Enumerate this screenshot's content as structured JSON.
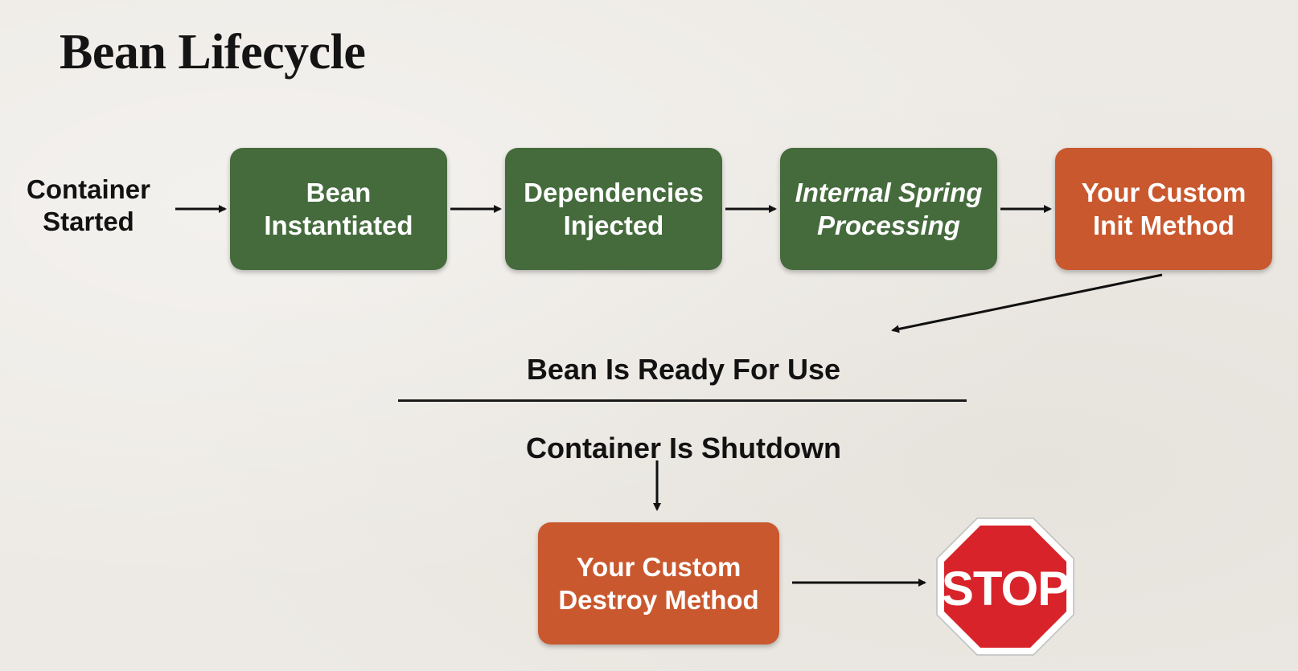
{
  "title": "Bean Lifecycle",
  "start": {
    "line1": "Container",
    "line2": "Started"
  },
  "steps": [
    {
      "line1": "Bean",
      "line2": "Instantiated",
      "color": "#456b3d"
    },
    {
      "line1": "Dependencies",
      "line2": "Injected",
      "color": "#456b3d"
    },
    {
      "line1": "Internal Spring",
      "line2": "Processing",
      "color": "#456b3d"
    },
    {
      "line1": "Your Custom",
      "line2": "Init Method",
      "color": "#c9582e"
    }
  ],
  "ready_label": "Bean Is Ready For Use",
  "shutdown_label": "Container Is Shutdown",
  "destroy": {
    "line1": "Your Custom",
    "line2": "Destroy Method",
    "color": "#c9582e"
  },
  "stop_sign": {
    "text": "STOP",
    "color": "#d8232a",
    "icon": "stop-sign-icon"
  }
}
